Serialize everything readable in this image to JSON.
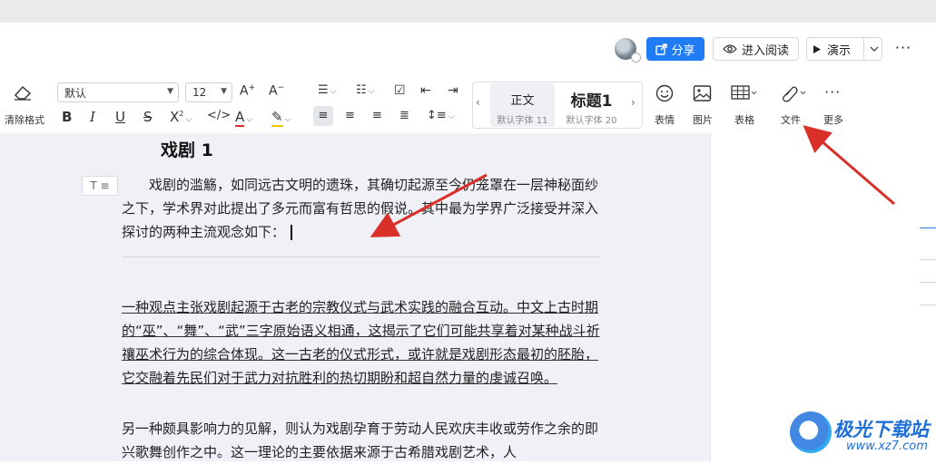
{
  "header": {
    "share_label": "分享",
    "read_label": "进入阅读",
    "present_label": "演示",
    "more_label": "···"
  },
  "toolbar": {
    "clear_format_label": "清除格式",
    "font_name": "默认",
    "font_size": "12",
    "styles": [
      {
        "name": "正文",
        "sub": "默认字体 11"
      },
      {
        "name": "标题1",
        "sub": "默认字体 20"
      }
    ],
    "insert_items": [
      {
        "label": "表情",
        "icon": "emoji-icon"
      },
      {
        "label": "图片",
        "icon": "image-icon"
      },
      {
        "label": "表格",
        "icon": "table-icon"
      },
      {
        "label": "文件",
        "icon": "attachment-icon"
      },
      {
        "label": "更多",
        "icon": "more-icon"
      }
    ]
  },
  "document": {
    "heading": "戏剧 1",
    "para_marker": "T ≡",
    "para1": "戏剧的滥觞，如同远古文明的遗珠，其确切起源至今仍笼罩在一层神秘面纱之下，学术界对此提出了多元而富有哲思的假说。其中最为学界广泛接受并深入探讨的两种主流观念如下：",
    "para2": "一种观点主张戏剧起源于古老的宗教仪式与武术实践的融合互动。中文上古时期的“巫”、“舞”、“武”三字原始语义相通，这揭示了它们可能共享着对某种战斗祈禳巫术行为的综合体现。这一古老的仪式形式，或许就是戏剧形态最初的胚胎，它交融着先民们对于武力对抗胜利的热切期盼和超自然力量的虔诚召唤。",
    "para3": "另一种颇具影响力的见解，则认为戏剧孕育于劳动人民欢庆丰收或劳作之余的即兴歌舞创作之中。这一理论的主要依据来源于古希腊戏剧艺术，人"
  },
  "watermark": {
    "name": "极光下载站",
    "url": "www.xz7.com"
  },
  "colors": {
    "accent": "#1f7cf5",
    "annotation_arrow": "#d9302a",
    "doc_background": "#eff1f7"
  }
}
